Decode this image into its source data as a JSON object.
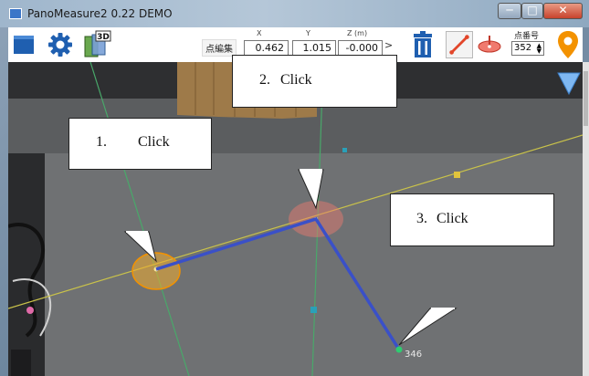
{
  "window": {
    "title": "PanoMeasure2 0.22 DEMO",
    "minimize": "─",
    "maximize": "□",
    "close": "✕"
  },
  "toolbar": {
    "open_icon": "folder-icon",
    "settings_icon": "gear-icon",
    "view3d_icon": "3d-view-icon",
    "view3d_label": "3D",
    "point_edit_label": "点編集",
    "x_label": "X",
    "y_label": "Y",
    "z_label": "Z (m)",
    "x_value": "0.462",
    "y_value": "1.015",
    "z_value": "-0.000",
    "next_label": ">",
    "delete_icon": "trash-icon",
    "line_icon": "line-measure-icon",
    "disc_icon": "plane-disc-icon",
    "point_number_label": "点番号",
    "point_number_value": "352",
    "pin_icon": "location-pin-icon",
    "accent_blue": "#1f5fb0",
    "accent_orange": "#f39200"
  },
  "viewport": {
    "point_label": "346",
    "nav_arrow_icon": "down-arrow-icon",
    "line_color": "#3a50c8",
    "axis_colors": {
      "green": "#49a86a",
      "yellow": "#c9c24a"
    }
  },
  "callouts": [
    {
      "number": "1.",
      "text": "Click"
    },
    {
      "number": "2.",
      "text": "Click"
    },
    {
      "number": "3.",
      "text": "Click"
    }
  ]
}
